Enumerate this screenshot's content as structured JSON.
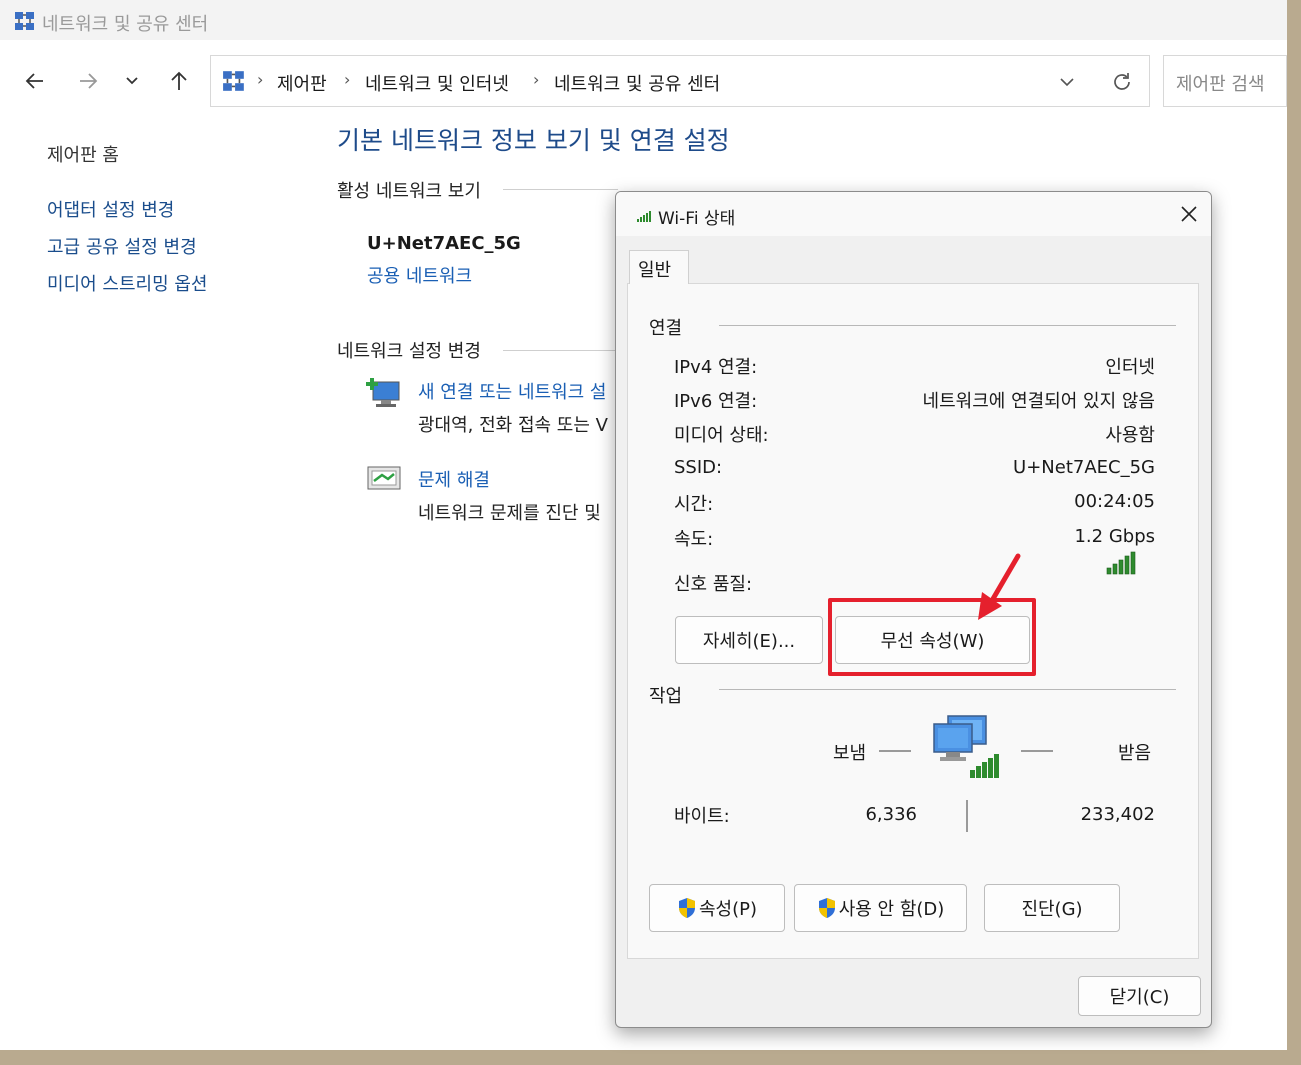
{
  "window": {
    "title": "네트워크 및 공유 센터"
  },
  "nav": {
    "breadcrumb": [
      "제어판",
      "네트워크 및 인터넷",
      "네트워크 및 공유 센터"
    ],
    "search_placeholder": "제어판 검색"
  },
  "sidebar": {
    "home": "제어판 홈",
    "items": [
      "어댑터 설정 변경",
      "고급 공유 설정 변경",
      "미디어 스트리밍 옵션"
    ]
  },
  "main": {
    "heading": "기본 네트워크 정보 보기 및 연결 설정",
    "active_section": "활성 네트워크 보기",
    "network_name": "U+Net7AEC_5G",
    "network_type": "공용 네트워크",
    "settings_section": "네트워크 설정 변경",
    "new_connection_link": "새 연결 또는 네트워크 설",
    "new_connection_desc": "광대역, 전화 접속 또는 V",
    "troubleshoot_link": "문제 해결",
    "troubleshoot_desc": "네트워크 문제를 진단 및"
  },
  "dialog": {
    "title": "Wi-Fi 상태",
    "tab": "일반",
    "connection_group": "연결",
    "rows": [
      {
        "label": "IPv4 연결:",
        "value": "인터넷"
      },
      {
        "label": "IPv6 연결:",
        "value": "네트워크에 연결되어 있지 않음"
      },
      {
        "label": "미디어 상태:",
        "value": "사용함"
      },
      {
        "label": "SSID:",
        "value": "U+Net7AEC_5G"
      },
      {
        "label": "시간:",
        "value": "00:24:05"
      },
      {
        "label": "속도:",
        "value": "1.2 Gbps"
      }
    ],
    "signal_label": "신호 품질:",
    "details_button": "자세히(E)...",
    "wireless_props_button": "무선 속성(W)",
    "activity_group": "작업",
    "sent_label": "보냄",
    "received_label": "받음",
    "bytes_label": "바이트:",
    "bytes_sent": "6,336",
    "bytes_received": "233,402",
    "properties_button": "속성(P)",
    "disable_button": "사용 안 함(D)",
    "diagnose_button": "진단(G)",
    "close_button": "닫기(C)"
  },
  "colors": {
    "link": "#1a5fb4",
    "heading": "#1e4b8a",
    "signal": "#2e8b2e",
    "highlight": "#e5202d"
  }
}
